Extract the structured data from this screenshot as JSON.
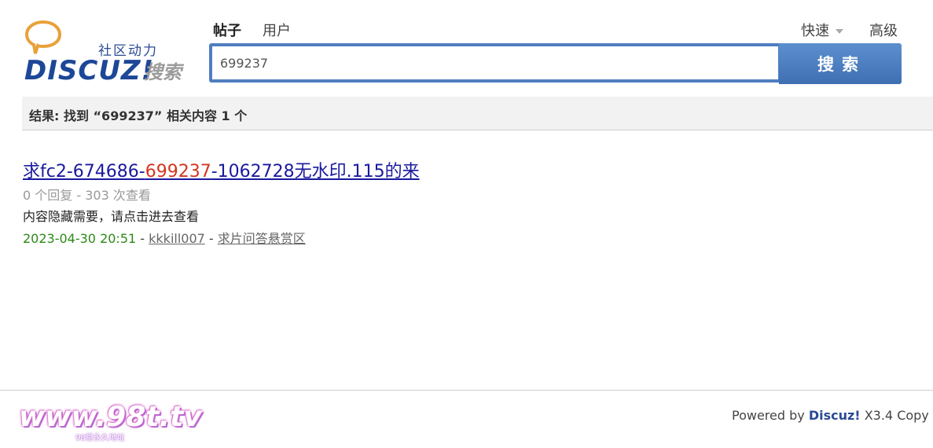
{
  "logo": {
    "tagline": "社区动力",
    "wordmark": "DISCUZ!",
    "search_word": "搜索"
  },
  "tabs": [
    {
      "label": "帖子",
      "active": true
    },
    {
      "label": "用户",
      "active": false
    }
  ],
  "header_links": {
    "quick": "快速",
    "advanced": "高级"
  },
  "search": {
    "value": "699237",
    "button_label": "搜索"
  },
  "results_summary": "结果: 找到 “699237” 相关内容 1 个",
  "results": [
    {
      "title_prefix": "求fc2-674686-",
      "title_highlight": "699237",
      "title_suffix": "-1062728无水印.115的来",
      "meta": "0 个回复 - 303 次查看",
      "excerpt": "内容隐藏需要，请点击进去查看",
      "date": "2023-04-30 20:51",
      "sep1": " - ",
      "author": "kkkill007",
      "sep2": " - ",
      "forum": "求片问答悬赏区"
    }
  ],
  "footer": {
    "logo_text": "www.98t.tv",
    "logo_sub": "98堂永久地址",
    "powered_prefix": "Powered by ",
    "powered_brand": "Discuz!",
    "powered_suffix": " X3.4   Copy"
  },
  "colors": {
    "brand_blue": "#2a4b93",
    "search_blue": "#4f7ec0",
    "link_blue": "#1a1a9e",
    "highlight_red": "#d3361f",
    "date_green": "#2b8a16"
  }
}
